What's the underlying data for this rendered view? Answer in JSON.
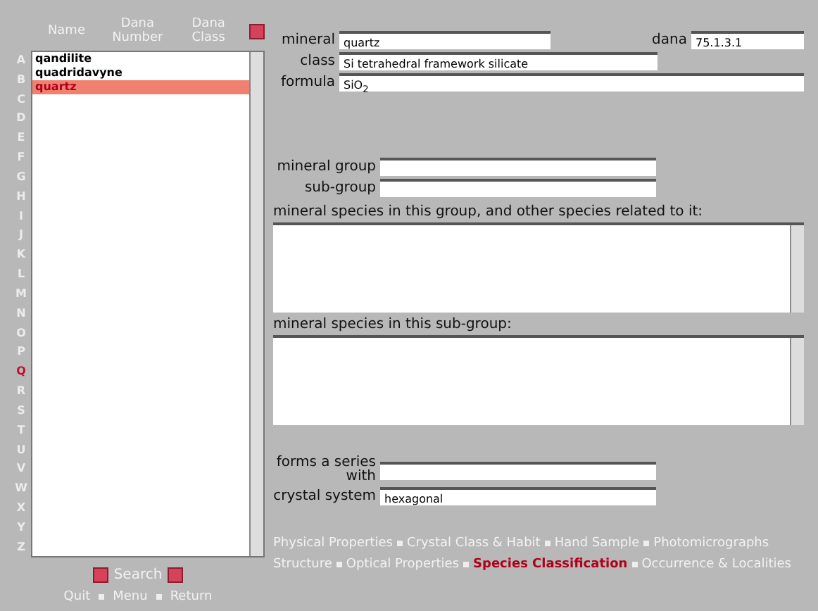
{
  "list_header": {
    "columns": [
      "Name",
      "Dana Number",
      "Dana Class"
    ]
  },
  "alphabet": [
    {
      "letter": "A",
      "selected": false
    },
    {
      "letter": "B",
      "selected": false
    },
    {
      "letter": "C",
      "selected": false
    },
    {
      "letter": "D",
      "selected": false
    },
    {
      "letter": "E",
      "selected": false
    },
    {
      "letter": "F",
      "selected": false
    },
    {
      "letter": "G",
      "selected": false
    },
    {
      "letter": "H",
      "selected": false
    },
    {
      "letter": "I",
      "selected": false
    },
    {
      "letter": "J",
      "selected": false
    },
    {
      "letter": "K",
      "selected": false
    },
    {
      "letter": "L",
      "selected": false
    },
    {
      "letter": "M",
      "selected": false
    },
    {
      "letter": "N",
      "selected": false
    },
    {
      "letter": "O",
      "selected": false
    },
    {
      "letter": "P",
      "selected": false
    },
    {
      "letter": "Q",
      "selected": true
    },
    {
      "letter": "R",
      "selected": false
    },
    {
      "letter": "S",
      "selected": false
    },
    {
      "letter": "T",
      "selected": false
    },
    {
      "letter": "U",
      "selected": false
    },
    {
      "letter": "V",
      "selected": false
    },
    {
      "letter": "W",
      "selected": false
    },
    {
      "letter": "X",
      "selected": false
    },
    {
      "letter": "Y",
      "selected": false
    },
    {
      "letter": "Z",
      "selected": false
    }
  ],
  "minerals": [
    {
      "name": "qandilite",
      "selected": false
    },
    {
      "name": "quadridavyne",
      "selected": false
    },
    {
      "name": "quartz",
      "selected": true
    }
  ],
  "search_label": "Search",
  "footer_links": [
    "Quit",
    "Menu",
    "Return"
  ],
  "form": {
    "mineral": {
      "label": "mineral",
      "value": "quartz"
    },
    "dana": {
      "label": "dana",
      "value": "75.1.3.1"
    },
    "class": {
      "label": "class",
      "value": "Si tetrahedral framework silicate"
    },
    "formula": {
      "label": "formula",
      "value": "SiO$_{2}$"
    },
    "mineral_group": {
      "label": "mineral group"
    },
    "sub_group": {
      "label": "sub-group"
    },
    "group_species": {
      "label": "mineral species in this group, and other species related to it:"
    },
    "subgroup_species": {
      "label": "mineral species in this sub-group:"
    },
    "series": {
      "label": "forms a series with"
    },
    "crystal_system": {
      "label": "crystal system",
      "value": "hexagonal"
    }
  },
  "nav_rows": [
    [
      {
        "label": "Physical Properties",
        "selected": false
      },
      {
        "label": "Crystal Class & Habit",
        "selected": false
      },
      {
        "label": "Hand Sample",
        "selected": false
      },
      {
        "label": "Photomicrographs",
        "selected": false
      }
    ],
    [
      {
        "label": "Structure",
        "selected": false
      },
      {
        "label": "Optical Properties",
        "selected": false
      },
      {
        "label": "Species Classification",
        "selected": true
      },
      {
        "label": "Occurrence & Localities",
        "selected": false
      }
    ]
  ]
}
